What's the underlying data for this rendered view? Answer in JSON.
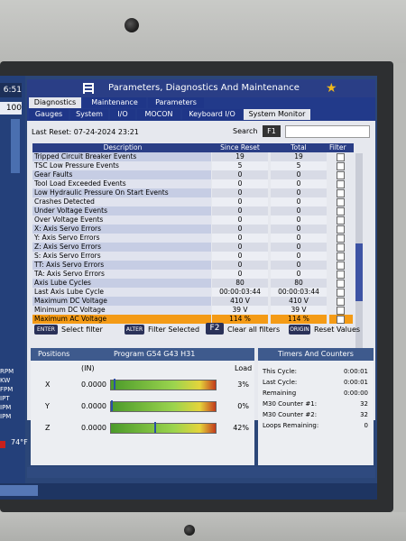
{
  "header": {
    "title": "Parameters, Diagnostics And Maintenance",
    "tabs_row1": [
      "Diagnostics",
      "Maintenance",
      "Parameters"
    ],
    "tabs_row2": [
      "Gauges",
      "System",
      "I/O",
      "MOCON",
      "Keyboard I/O",
      "System Monitor"
    ]
  },
  "left": {
    "clock": "6:51",
    "percent": "100",
    "labels": [
      "RPM",
      "KW",
      "FPM",
      "IPT",
      "IPM",
      "IPM"
    ],
    "temp": "74°F"
  },
  "toolbar": {
    "last_reset": "Last Reset: 07-24-2024 23:21",
    "search_label": "Search",
    "search_key": "F1"
  },
  "table": {
    "headers": [
      "Description",
      "Since Reset",
      "Total",
      "Filter"
    ],
    "rows": [
      {
        "d": "Tripped Circuit Breaker Events",
        "s": "19",
        "t": "19"
      },
      {
        "d": "TSC Low Pressure Events",
        "s": "5",
        "t": "5"
      },
      {
        "d": "Gear Faults",
        "s": "0",
        "t": "0"
      },
      {
        "d": "Tool Load Exceeded Events",
        "s": "0",
        "t": "0"
      },
      {
        "d": "Low Hydraulic Pressure On Start Events",
        "s": "0",
        "t": "0"
      },
      {
        "d": "Crashes Detected",
        "s": "0",
        "t": "0"
      },
      {
        "d": "Under Voltage Events",
        "s": "0",
        "t": "0"
      },
      {
        "d": "Over Voltage Events",
        "s": "0",
        "t": "0"
      },
      {
        "d": "X: Axis Servo Errors",
        "s": "0",
        "t": "0"
      },
      {
        "d": "Y: Axis Servo Errors",
        "s": "0",
        "t": "0"
      },
      {
        "d": "Z: Axis Servo Errors",
        "s": "0",
        "t": "0"
      },
      {
        "d": "S: Axis Servo Errors",
        "s": "0",
        "t": "0"
      },
      {
        "d": "TT: Axis Servo Errors",
        "s": "0",
        "t": "0"
      },
      {
        "d": "TA: Axis Servo Errors",
        "s": "0",
        "t": "0"
      },
      {
        "d": "Axis Lube Cycles",
        "s": "80",
        "t": "80"
      },
      {
        "d": "Last Axis Lube Cycle",
        "s": "00:00:03:44",
        "t": "00:00:03:44"
      },
      {
        "d": "Maximum DC Voltage",
        "s": "410 V",
        "t": "410 V"
      },
      {
        "d": "Minimum DC Voltage",
        "s": "39 V",
        "t": "39 V"
      },
      {
        "d": "Maximum AC Voltage",
        "s": "114 %",
        "t": "114 %"
      }
    ],
    "highlight_color": "#f49b16"
  },
  "hints": {
    "enter_key": "ENTER",
    "enter_label": "Select filter",
    "alter_key": "ALTER",
    "alter_label": "Filter Selected",
    "f2_key": "F2",
    "f2_label": "Clear all filters",
    "origin_key": "ORIGIN",
    "origin_label": "Reset Values"
  },
  "positions": {
    "title": "Positions",
    "program": "Program G54 G43 H31",
    "unit": "(IN)",
    "load_label": "Load",
    "axes": [
      {
        "axis": "X",
        "value": "0.0000",
        "load": "3%",
        "level": 0.03
      },
      {
        "axis": "Y",
        "value": "0.0000",
        "load": "0%",
        "level": 0.0
      },
      {
        "axis": "Z",
        "value": "0.0000",
        "load": "42%",
        "level": 0.42
      }
    ]
  },
  "timers": {
    "title": "Timers And Counters",
    "items": [
      {
        "label": "This Cycle:",
        "value": "0:00:01"
      },
      {
        "label": "Last Cycle:",
        "value": "0:00:01"
      },
      {
        "label": "Remaining",
        "value": "0:00:00"
      },
      {
        "label": "M30 Counter #1:",
        "value": "32"
      },
      {
        "label": "M30 Counter #2:",
        "value": "32"
      },
      {
        "label": "Loops Remaining:",
        "value": "0"
      }
    ]
  }
}
